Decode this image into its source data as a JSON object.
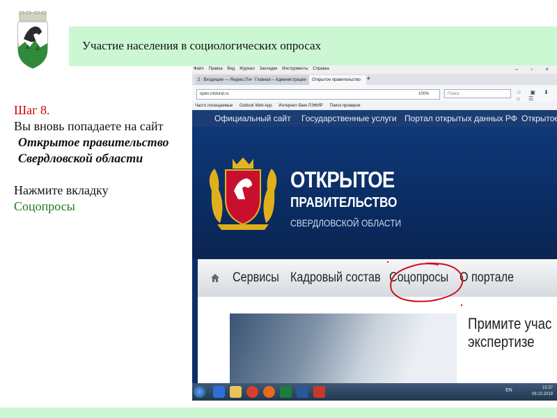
{
  "slide": {
    "title": "Участие населения в социологических опросах",
    "step": "Шаг 8.",
    "line1": "Вы вновь попадаете на сайт",
    "site_name": "Открытое правительство Свердловской области",
    "instruction": "Нажмите  вкладку",
    "target_tab": "Соцопросы"
  },
  "browser": {
    "menu": [
      "Файл",
      "Правка",
      "Вид",
      "Журнал",
      "Закладки",
      "Инструменты",
      "Справка"
    ],
    "window_controls": "– ▫ ×",
    "tabs": [
      "2 · Входящие — Яндекс.Почта",
      "Главная – Администрация",
      "Открытое правительство"
    ],
    "new_tab": "+",
    "url": "open.midural.ru",
    "zoom": "100%",
    "search_placeholder": "Поиск",
    "nav_icons": "☆ ▣ ⬇ ⌂ ☰",
    "bookmarks": [
      "Часто посещаемые",
      "Outlook Web App",
      "Интернет-банк ЛЭФИР",
      "Поиск проверок"
    ]
  },
  "site": {
    "top_nav": [
      "Официальный сайт",
      "Государственные услуги",
      "Портал открытых данных РФ",
      "Открытое"
    ],
    "brand_line1": "ОТКРЫТОЕ",
    "brand_line2": "ПРАВИТЕЛЬСТВО",
    "brand_line3": "СВЕРДЛОВСКОЙ ОБЛАСТИ",
    "main_nav": [
      "Сервисы",
      "Кадровый состав",
      "Соцопросы",
      "О портале"
    ],
    "promo_line1": "Примите учас",
    "promo_line2": "экспертизе"
  },
  "taskbar": {
    "lang": "EN",
    "time": "15:37",
    "date": "09.10.2019"
  },
  "colors": {
    "header_bg": "#ccf7d3",
    "step_red": "#d40000",
    "highlight_green": "#1a7a1a",
    "site_dark_blue": "#0e2f66",
    "circle_red": "#d0101c"
  }
}
